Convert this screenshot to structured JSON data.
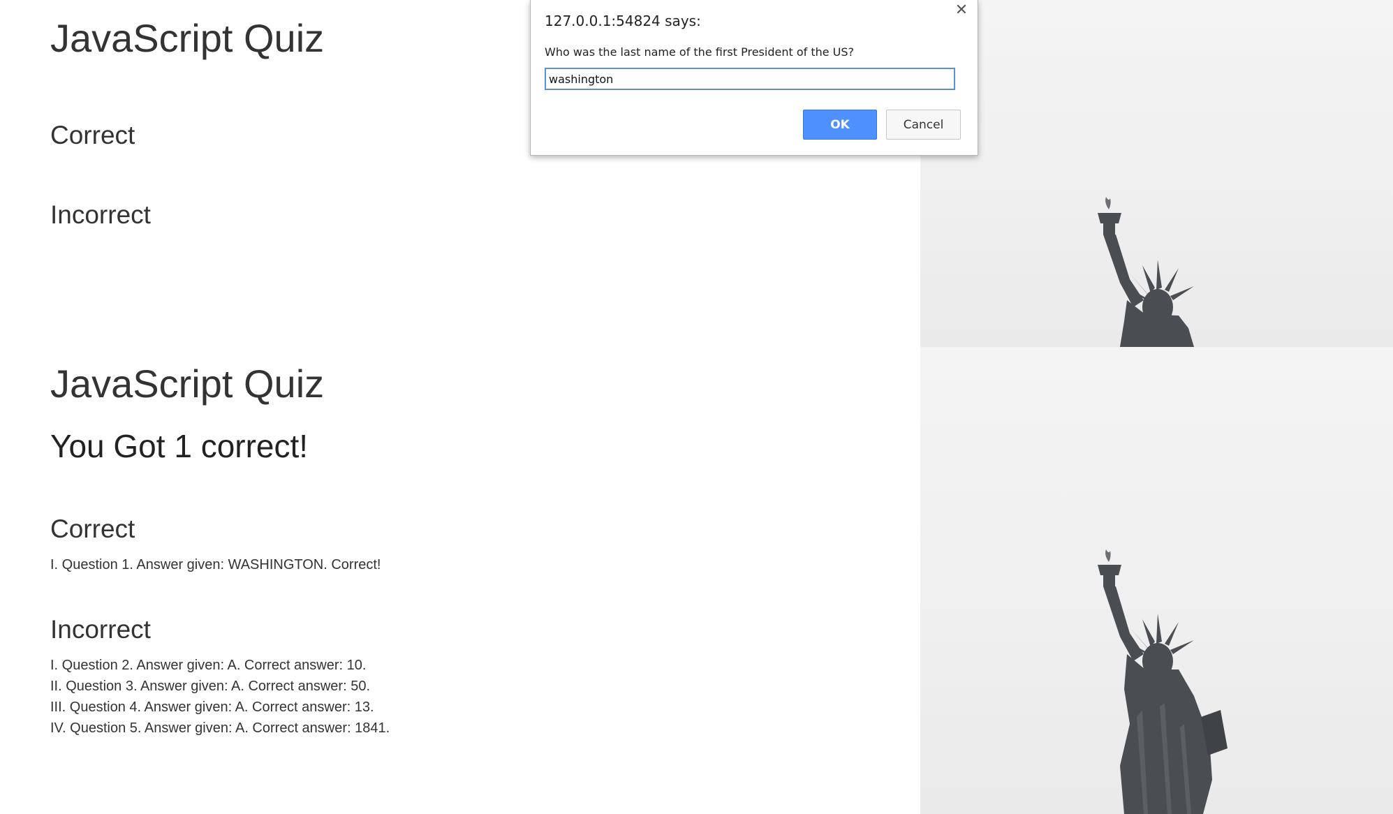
{
  "top_page": {
    "title": "JavaScript Quiz",
    "correct_heading": "Correct",
    "incorrect_heading": "Incorrect"
  },
  "dialog": {
    "title": "127.0.0.1:54824 says:",
    "message": "Who was the last name of the first President of the US?",
    "input_value": "washington",
    "ok_label": "OK",
    "cancel_label": "Cancel",
    "close_icon": "close-icon"
  },
  "bottom_page": {
    "title": "JavaScript Quiz",
    "score": "You Got 1 correct!",
    "correct_heading": "Correct",
    "correct_items": [
      "I. Question 1. Answer given: WASHINGTON. Correct!"
    ],
    "incorrect_heading": "Incorrect",
    "incorrect_items": [
      "I. Question 2. Answer given: A. Correct answer: 10.",
      "II. Question 3. Answer given: A. Correct answer: 50.",
      "III. Question 4. Answer given: A. Correct answer: 13.",
      "IV. Question 5. Answer given: A. Correct answer: 1841."
    ]
  },
  "colors": {
    "ok_button": "#4d90fe",
    "input_focus_border": "#5b8fd8",
    "text": "#333333"
  }
}
